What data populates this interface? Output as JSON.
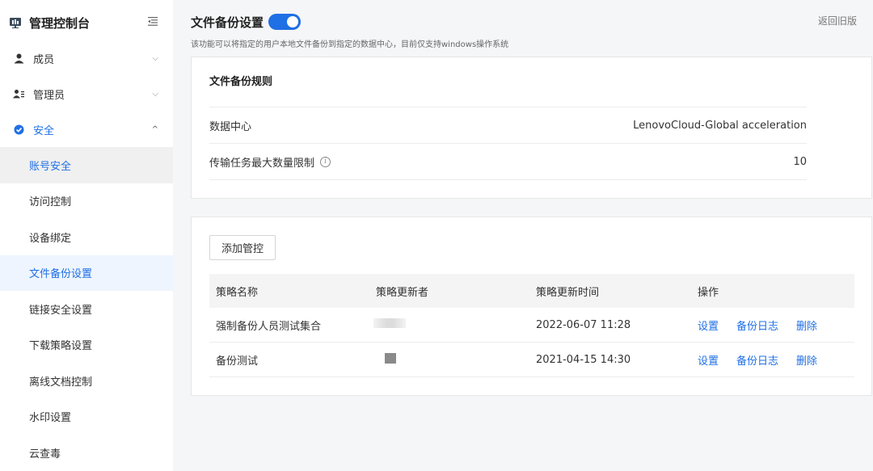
{
  "app": {
    "title": "管理控制台",
    "collapse_icon": "menu-fold-icon"
  },
  "sidebar": {
    "groups": [
      {
        "label": "成员",
        "icon": "user-icon",
        "expanded": false
      },
      {
        "label": "管理员",
        "icon": "admin-users-icon",
        "expanded": false
      },
      {
        "label": "安全",
        "icon": "shield-check-icon",
        "expanded": true
      }
    ],
    "security_items": [
      {
        "label": "账号安全"
      },
      {
        "label": "访问控制"
      },
      {
        "label": "设备绑定"
      },
      {
        "label": "文件备份设置",
        "selected": true
      },
      {
        "label": "链接安全设置"
      },
      {
        "label": "下载策略设置"
      },
      {
        "label": "离线文档控制"
      },
      {
        "label": "水印设置"
      },
      {
        "label": "云查毒"
      }
    ]
  },
  "page": {
    "title": "文件备份设置",
    "enabled": true,
    "description": "该功能可以将指定的用户本地文件备份到指定的数据中心，目前仅支持windows操作系统",
    "back_link": "返回旧版"
  },
  "rules": {
    "title": "文件备份规则",
    "data_center_label": "数据中心",
    "data_center_value": "LenovoCloud-Global acceleration",
    "max_tasks_label": "传输任务最大数量限制",
    "max_tasks_value": "10"
  },
  "policies": {
    "add_button": "添加管控",
    "columns": [
      "策略名称",
      "策略更新者",
      "策略更新时间",
      "操作"
    ],
    "rows": [
      {
        "name": "强制备份人员测试集合",
        "updated_at": "2022-06-07 11:28"
      },
      {
        "name": "备份测试",
        "updated_at": "2021-04-15 14:30"
      }
    ],
    "actions": {
      "settings": "设置",
      "log": "备份日志",
      "delete": "删除"
    }
  },
  "colors": {
    "accent": "#1f6fe5",
    "background": "#f5f6f7"
  }
}
